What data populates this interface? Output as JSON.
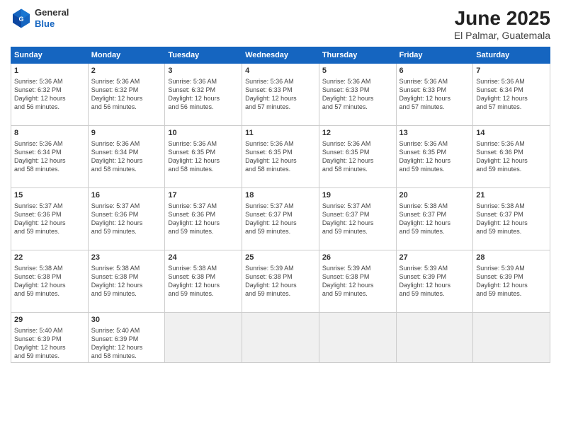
{
  "header": {
    "logo_line1": "General",
    "logo_line2": "Blue",
    "title": "June 2025",
    "subtitle": "El Palmar, Guatemala"
  },
  "calendar": {
    "days_of_week": [
      "Sunday",
      "Monday",
      "Tuesday",
      "Wednesday",
      "Thursday",
      "Friday",
      "Saturday"
    ],
    "weeks": [
      [
        {
          "day": "",
          "info": "",
          "empty": true
        },
        {
          "day": "",
          "info": "",
          "empty": true
        },
        {
          "day": "",
          "info": "",
          "empty": true
        },
        {
          "day": "",
          "info": "",
          "empty": true
        },
        {
          "day": "",
          "info": "",
          "empty": true
        },
        {
          "day": "",
          "info": "",
          "empty": true
        },
        {
          "day": "",
          "info": "",
          "empty": true
        }
      ],
      [
        {
          "day": "1",
          "info": "Sunrise: 5:36 AM\nSunset: 6:32 PM\nDaylight: 12 hours\nand 56 minutes.",
          "empty": false
        },
        {
          "day": "2",
          "info": "Sunrise: 5:36 AM\nSunset: 6:32 PM\nDaylight: 12 hours\nand 56 minutes.",
          "empty": false
        },
        {
          "day": "3",
          "info": "Sunrise: 5:36 AM\nSunset: 6:32 PM\nDaylight: 12 hours\nand 56 minutes.",
          "empty": false
        },
        {
          "day": "4",
          "info": "Sunrise: 5:36 AM\nSunset: 6:33 PM\nDaylight: 12 hours\nand 57 minutes.",
          "empty": false
        },
        {
          "day": "5",
          "info": "Sunrise: 5:36 AM\nSunset: 6:33 PM\nDaylight: 12 hours\nand 57 minutes.",
          "empty": false
        },
        {
          "day": "6",
          "info": "Sunrise: 5:36 AM\nSunset: 6:33 PM\nDaylight: 12 hours\nand 57 minutes.",
          "empty": false
        },
        {
          "day": "7",
          "info": "Sunrise: 5:36 AM\nSunset: 6:34 PM\nDaylight: 12 hours\nand 57 minutes.",
          "empty": false
        }
      ],
      [
        {
          "day": "8",
          "info": "Sunrise: 5:36 AM\nSunset: 6:34 PM\nDaylight: 12 hours\nand 58 minutes.",
          "empty": false
        },
        {
          "day": "9",
          "info": "Sunrise: 5:36 AM\nSunset: 6:34 PM\nDaylight: 12 hours\nand 58 minutes.",
          "empty": false
        },
        {
          "day": "10",
          "info": "Sunrise: 5:36 AM\nSunset: 6:35 PM\nDaylight: 12 hours\nand 58 minutes.",
          "empty": false
        },
        {
          "day": "11",
          "info": "Sunrise: 5:36 AM\nSunset: 6:35 PM\nDaylight: 12 hours\nand 58 minutes.",
          "empty": false
        },
        {
          "day": "12",
          "info": "Sunrise: 5:36 AM\nSunset: 6:35 PM\nDaylight: 12 hours\nand 58 minutes.",
          "empty": false
        },
        {
          "day": "13",
          "info": "Sunrise: 5:36 AM\nSunset: 6:35 PM\nDaylight: 12 hours\nand 59 minutes.",
          "empty": false
        },
        {
          "day": "14",
          "info": "Sunrise: 5:36 AM\nSunset: 6:36 PM\nDaylight: 12 hours\nand 59 minutes.",
          "empty": false
        }
      ],
      [
        {
          "day": "15",
          "info": "Sunrise: 5:37 AM\nSunset: 6:36 PM\nDaylight: 12 hours\nand 59 minutes.",
          "empty": false
        },
        {
          "day": "16",
          "info": "Sunrise: 5:37 AM\nSunset: 6:36 PM\nDaylight: 12 hours\nand 59 minutes.",
          "empty": false
        },
        {
          "day": "17",
          "info": "Sunrise: 5:37 AM\nSunset: 6:36 PM\nDaylight: 12 hours\nand 59 minutes.",
          "empty": false
        },
        {
          "day": "18",
          "info": "Sunrise: 5:37 AM\nSunset: 6:37 PM\nDaylight: 12 hours\nand 59 minutes.",
          "empty": false
        },
        {
          "day": "19",
          "info": "Sunrise: 5:37 AM\nSunset: 6:37 PM\nDaylight: 12 hours\nand 59 minutes.",
          "empty": false
        },
        {
          "day": "20",
          "info": "Sunrise: 5:38 AM\nSunset: 6:37 PM\nDaylight: 12 hours\nand 59 minutes.",
          "empty": false
        },
        {
          "day": "21",
          "info": "Sunrise: 5:38 AM\nSunset: 6:37 PM\nDaylight: 12 hours\nand 59 minutes.",
          "empty": false
        }
      ],
      [
        {
          "day": "22",
          "info": "Sunrise: 5:38 AM\nSunset: 6:38 PM\nDaylight: 12 hours\nand 59 minutes.",
          "empty": false
        },
        {
          "day": "23",
          "info": "Sunrise: 5:38 AM\nSunset: 6:38 PM\nDaylight: 12 hours\nand 59 minutes.",
          "empty": false
        },
        {
          "day": "24",
          "info": "Sunrise: 5:38 AM\nSunset: 6:38 PM\nDaylight: 12 hours\nand 59 minutes.",
          "empty": false
        },
        {
          "day": "25",
          "info": "Sunrise: 5:39 AM\nSunset: 6:38 PM\nDaylight: 12 hours\nand 59 minutes.",
          "empty": false
        },
        {
          "day": "26",
          "info": "Sunrise: 5:39 AM\nSunset: 6:38 PM\nDaylight: 12 hours\nand 59 minutes.",
          "empty": false
        },
        {
          "day": "27",
          "info": "Sunrise: 5:39 AM\nSunset: 6:39 PM\nDaylight: 12 hours\nand 59 minutes.",
          "empty": false
        },
        {
          "day": "28",
          "info": "Sunrise: 5:39 AM\nSunset: 6:39 PM\nDaylight: 12 hours\nand 59 minutes.",
          "empty": false
        }
      ],
      [
        {
          "day": "29",
          "info": "Sunrise: 5:40 AM\nSunset: 6:39 PM\nDaylight: 12 hours\nand 59 minutes.",
          "empty": false
        },
        {
          "day": "30",
          "info": "Sunrise: 5:40 AM\nSunset: 6:39 PM\nDaylight: 12 hours\nand 58 minutes.",
          "empty": false
        },
        {
          "day": "",
          "info": "",
          "empty": true
        },
        {
          "day": "",
          "info": "",
          "empty": true
        },
        {
          "day": "",
          "info": "",
          "empty": true
        },
        {
          "day": "",
          "info": "",
          "empty": true
        },
        {
          "day": "",
          "info": "",
          "empty": true
        }
      ]
    ]
  }
}
